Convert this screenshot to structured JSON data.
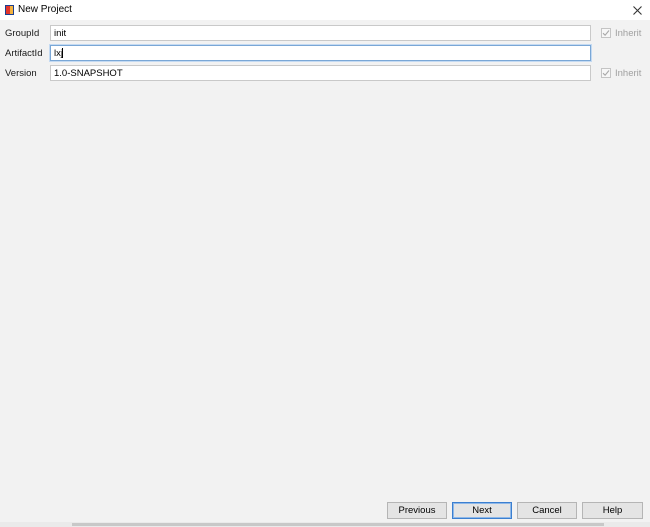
{
  "window": {
    "title": "New Project",
    "close_glyph": "✕"
  },
  "icons": {
    "app": "intellij-project-icon",
    "close": "close-icon",
    "check": "checkmark-icon"
  },
  "form": {
    "groupid": {
      "label": "GroupId",
      "value": "init",
      "inherit_label": "Inherit",
      "inherit_checked": true
    },
    "artifactid": {
      "label": "ArtifactId",
      "value": "lxj"
    },
    "version": {
      "label": "Version",
      "value": "1.0-SNAPSHOT",
      "inherit_label": "Inherit",
      "inherit_checked": true
    }
  },
  "buttons": {
    "previous": "Previous",
    "next": "Next",
    "cancel": "Cancel",
    "help": "Help"
  },
  "colors": {
    "background": "#f2f2f2",
    "focus_border": "#7aa7d6",
    "default_button_border": "#3b7fd0",
    "disabled_text": "#a0a0a0"
  }
}
